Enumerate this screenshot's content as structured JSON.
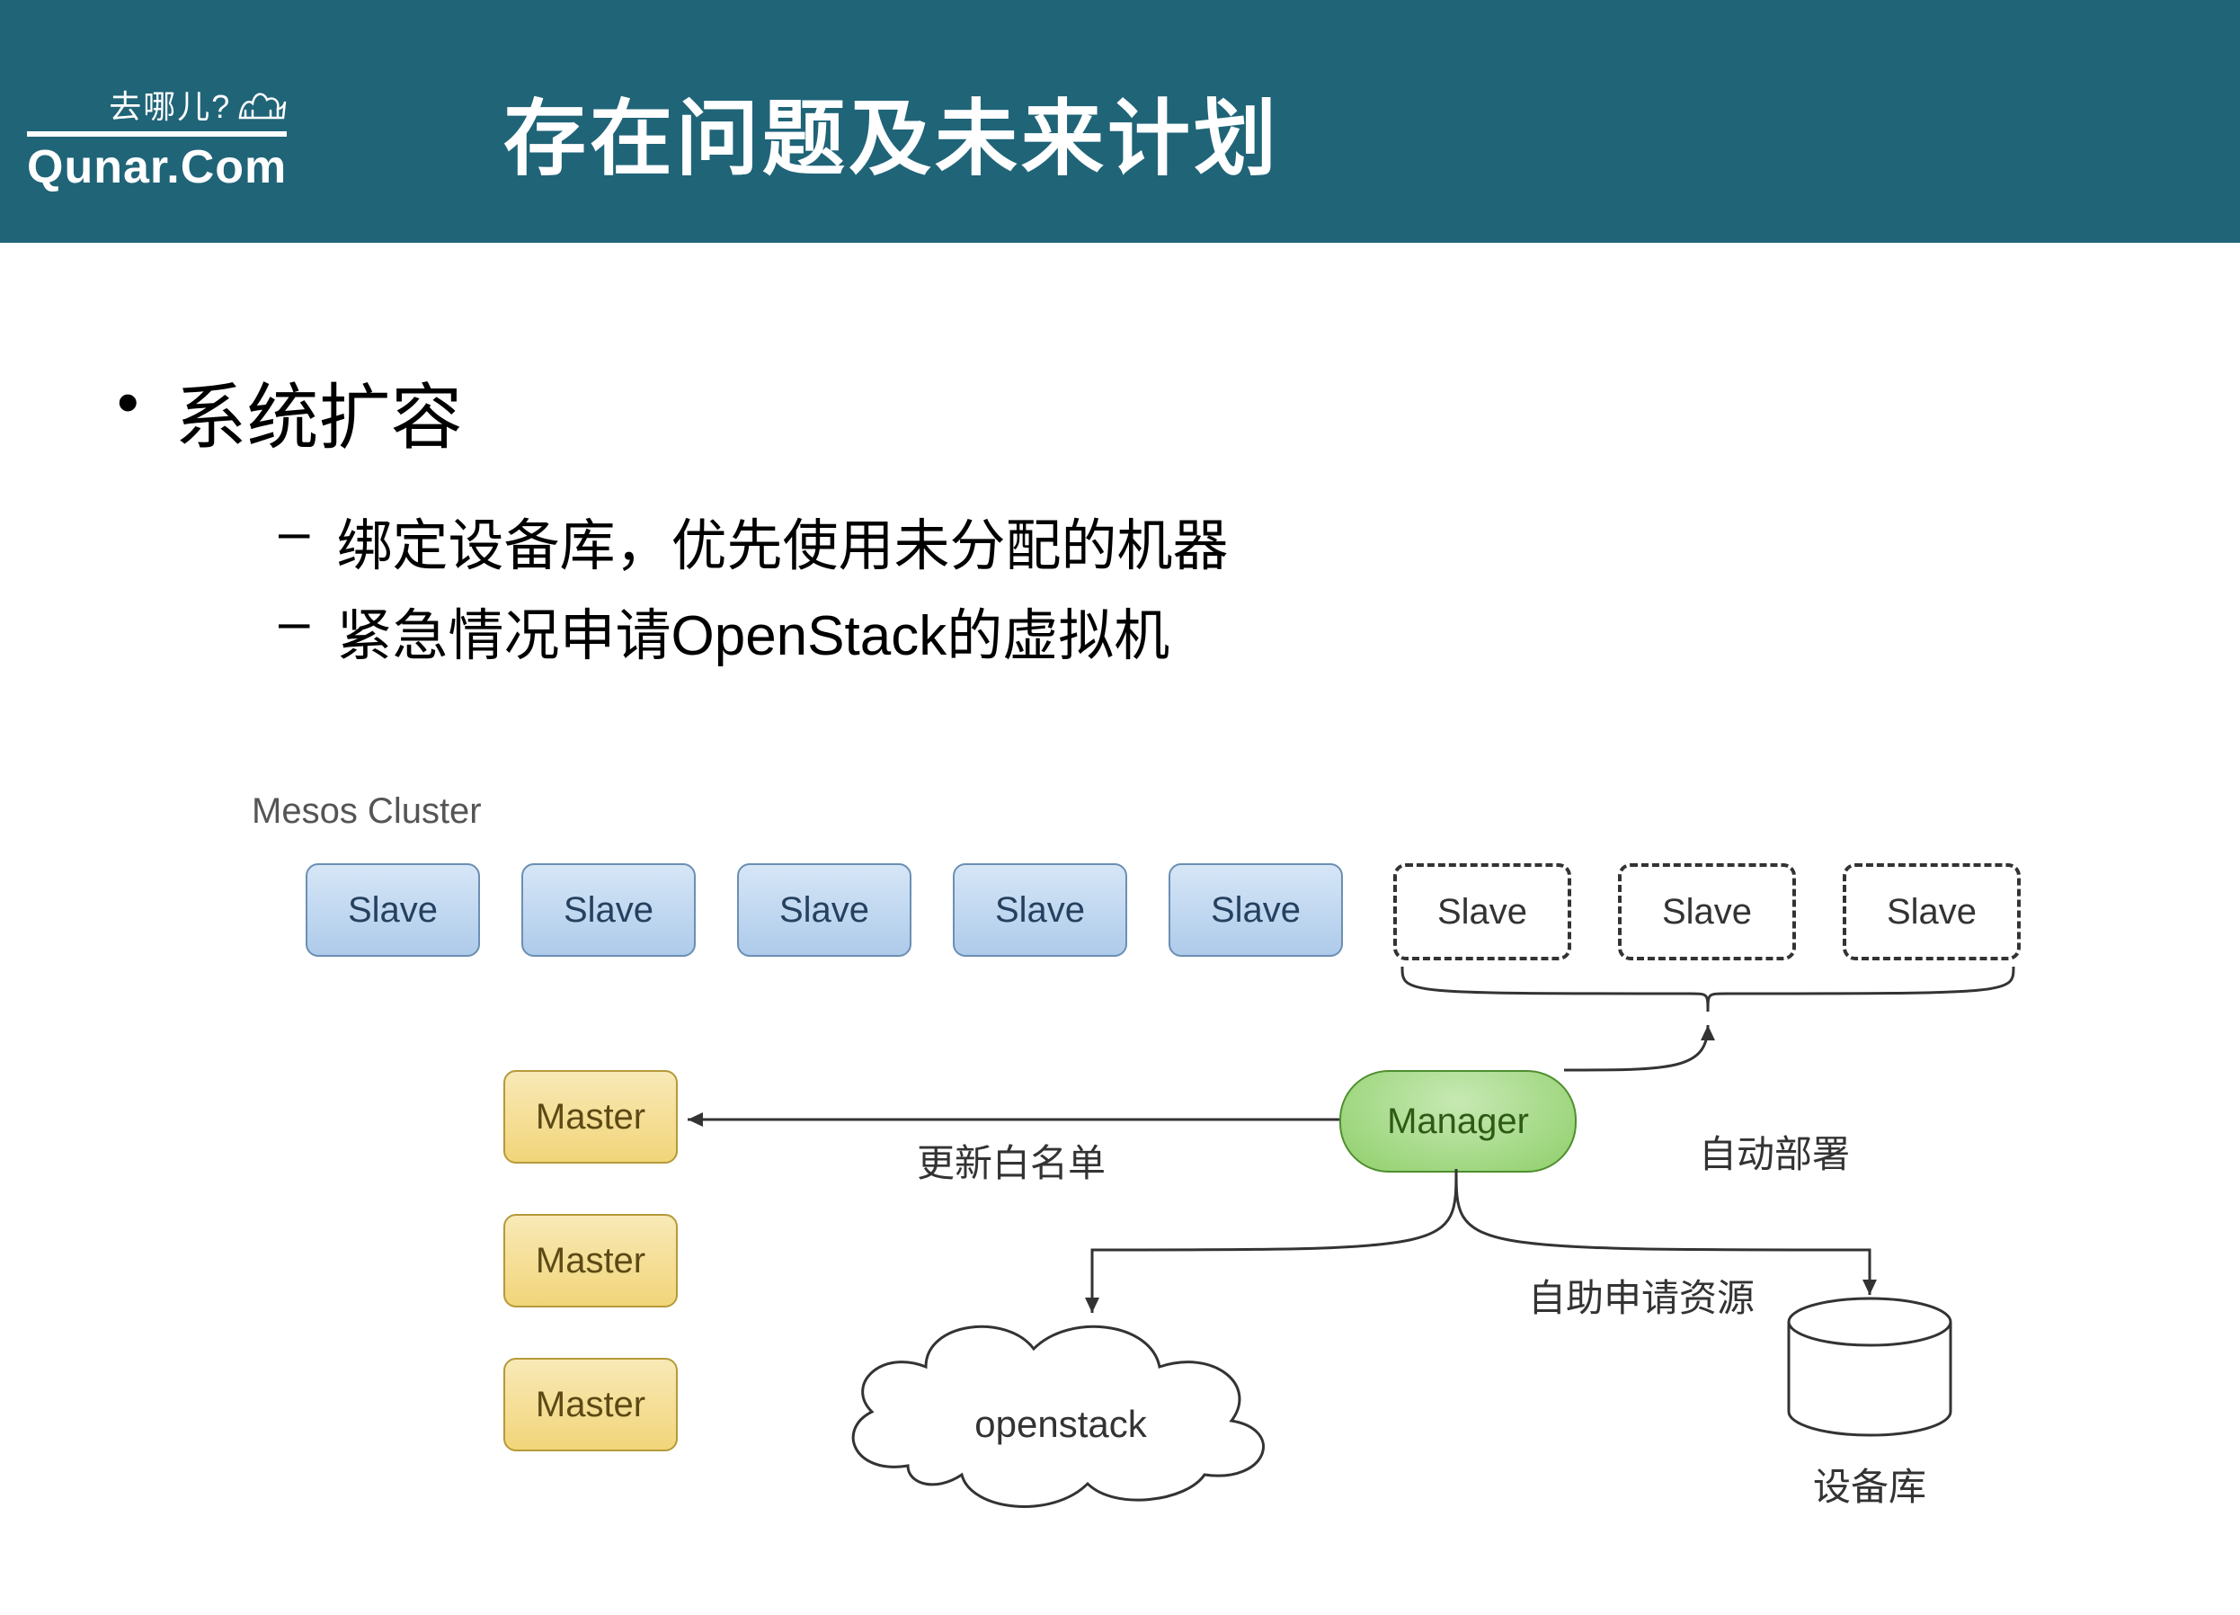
{
  "logo": {
    "line1": "去哪儿?",
    "line2": "Qunar.Com",
    "icon": "camel-icon"
  },
  "title": "存在问题及未来计划",
  "bullets": {
    "b1": "系统扩容",
    "b1_1": "绑定设备库，优先使用未分配的机器",
    "b1_2": "紧急情况申请OpenStack的虚拟机"
  },
  "diagram": {
    "cluster_label": "Mesos Cluster",
    "slaves": [
      "Slave",
      "Slave",
      "Slave",
      "Slave",
      "Slave"
    ],
    "dashed_slaves": [
      "Slave",
      "Slave",
      "Slave"
    ],
    "masters": [
      "Master",
      "Master",
      "Master"
    ],
    "manager": "Manager",
    "openstack": "openstack",
    "device_repo": "设备库",
    "edge_update_whitelist": "更新白名单",
    "edge_auto_deploy": "自动部署",
    "edge_self_request": "自助申请资源"
  }
}
